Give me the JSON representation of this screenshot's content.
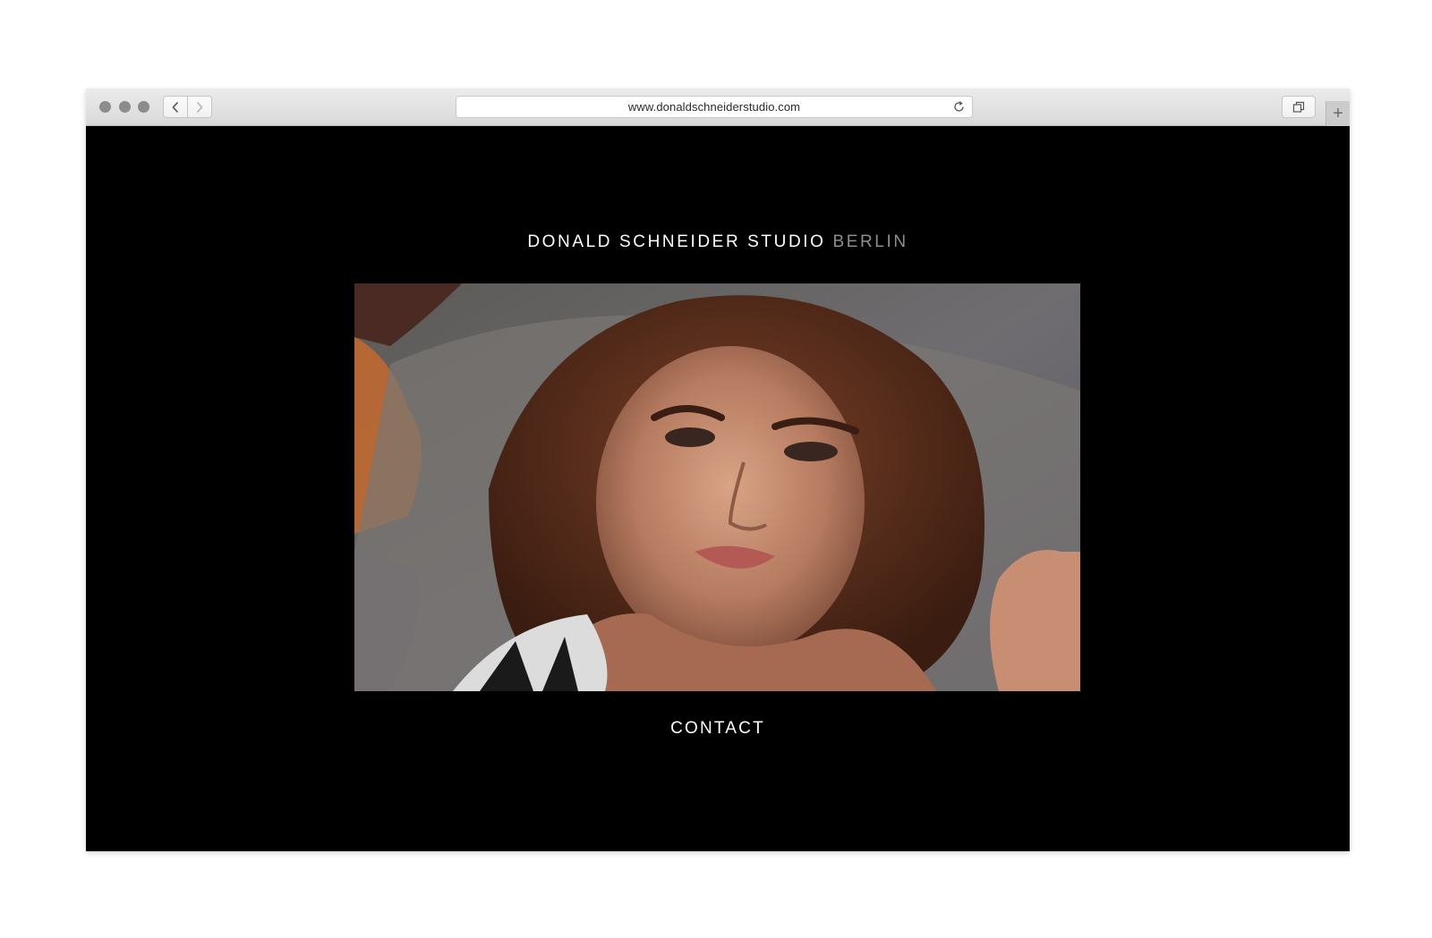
{
  "browser": {
    "url": "www.donaldschneiderstudio.com",
    "new_tab_glyph": "+"
  },
  "site": {
    "brand_name": "DONALD SCHNEIDER STUDIO",
    "brand_city": "BERLIN",
    "contact_label": "CONTACT"
  },
  "icons": {
    "back": "chevron-left-icon",
    "forward": "chevron-right-icon",
    "reload": "reload-icon",
    "tabs": "tab-overview-icon",
    "new_tab": "plus-icon"
  },
  "colors": {
    "page_background": "#000000",
    "brand_city": "#8e8e8e",
    "text": "#ffffff"
  }
}
